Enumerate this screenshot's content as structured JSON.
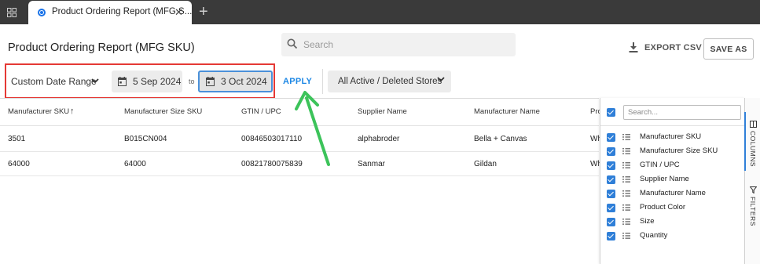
{
  "browser": {
    "tab_title": "Product Ordering Report (MFG S...",
    "close_glyph": "✕",
    "newtab_glyph": "+"
  },
  "header": {
    "title": "Product Ordering Report (MFG SKU)",
    "search_placeholder": "Search",
    "export_label": "EXPORT CSV",
    "save_as_label": "SAVE AS"
  },
  "filters": {
    "date_range_label": "Custom Date Range",
    "start_date": "5 Sep 2024",
    "to_label": "to",
    "end_date": "3 Oct 2024",
    "apply_label": "APPLY",
    "stores_label": "All Active / Deleted Stores"
  },
  "table": {
    "columns": [
      "Manufacturer SKU",
      "Manufacturer Size SKU",
      "GTIN / UPC",
      "Supplier Name",
      "Manufacturer Name",
      "Pro"
    ],
    "sort_indicator": "↑",
    "rows": [
      [
        "3501",
        "B015CN004",
        "00846503017110",
        "alphabroder",
        "Bella + Canvas",
        "Wh"
      ],
      [
        "64000",
        "64000",
        "00821780075839",
        "Sanmar",
        "Gildan",
        "Wh"
      ]
    ]
  },
  "column_panel": {
    "search_placeholder": "Search...",
    "items": [
      {
        "label": "Manufacturer SKU",
        "checked": true
      },
      {
        "label": "Manufacturer Size SKU",
        "checked": true
      },
      {
        "label": "GTIN / UPC",
        "checked": true
      },
      {
        "label": "Supplier Name",
        "checked": true
      },
      {
        "label": "Manufacturer Name",
        "checked": true
      },
      {
        "label": "Product Color",
        "checked": true
      },
      {
        "label": "Size",
        "checked": true
      },
      {
        "label": "Quantity",
        "checked": true
      }
    ]
  },
  "side_tabs": {
    "columns_label": "COLUMNS",
    "filters_label": "FILTERS"
  },
  "colors": {
    "accent": "#2f7fd8",
    "apply": "#1e88e5",
    "highlight_box": "#e53935",
    "annotation_arrow": "#3cc35a"
  }
}
